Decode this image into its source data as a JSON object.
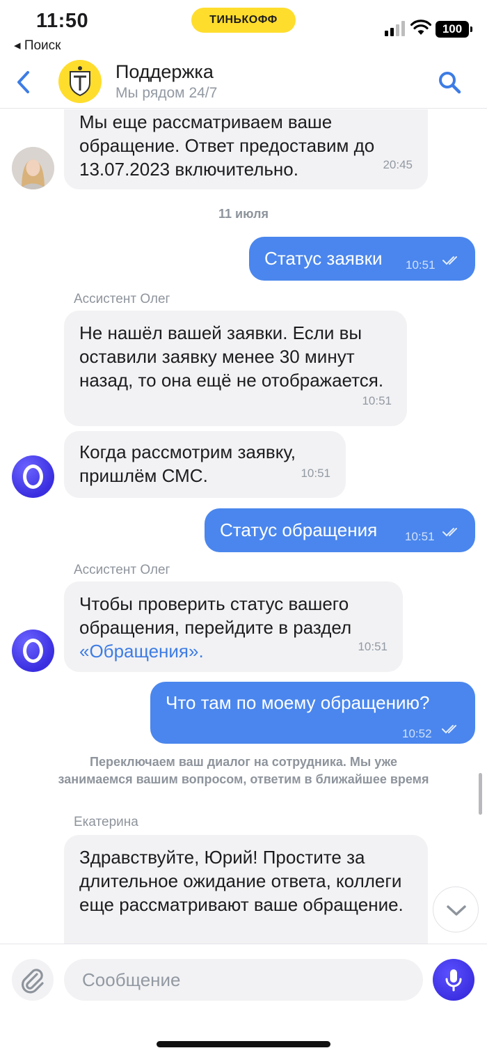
{
  "status_bar": {
    "time": "11:50",
    "brand": "ТИНЬКОФФ",
    "back_label": "◂ Поиск",
    "battery": "100"
  },
  "header": {
    "title": "Поддержка",
    "subtitle": "Мы рядом 24/7"
  },
  "messages": [
    {
      "direction": "incoming",
      "text": "Мы еще рассматриваем ваше обращение. Ответ предоставим до 13.07.2023 включительно.",
      "time": "20:45"
    },
    {
      "type": "date",
      "text": "11 июля"
    },
    {
      "direction": "outgoing",
      "text": "Статус заявки",
      "time": "10:51",
      "read": true
    },
    {
      "sender": "Ассистент Олег"
    },
    {
      "direction": "incoming",
      "text": "Не нашёл вашей заявки. Если вы оставили заявку менее 30 минут назад, то она ещё не отображается.",
      "time": "10:51"
    },
    {
      "direction": "incoming",
      "text": "Когда рассмотрим заявку, пришлём СМС.",
      "time": "10:51"
    },
    {
      "direction": "outgoing",
      "text": "Статус обращения",
      "time": "10:51",
      "read": true
    },
    {
      "sender": "Ассистент Олег"
    },
    {
      "direction": "incoming",
      "text": "Чтобы проверить статус вашего обращения, перейдите в раздел",
      "link": "«Обращения».",
      "time": "10:51"
    },
    {
      "direction": "outgoing",
      "text": "Что там по моему обращению?",
      "time": "10:52",
      "read": true
    },
    {
      "type": "system",
      "text": "Переключаем ваш диалог на сотрудника. Мы уже занимаемся вашим вопросом, ответим в ближайшее время"
    },
    {
      "sender": "Екатерина"
    },
    {
      "direction": "incoming",
      "text": "Здравствуйте, Юрий! Простите за длительное ожидание ответа, коллеги еще рассматривают ваше обращение."
    }
  ],
  "composer": {
    "placeholder": "Сообщение"
  },
  "colors": {
    "accent": "#4a86ed",
    "brand_yellow": "#ffdd2d",
    "incoming_bubble": "#f2f2f4",
    "bot_avatar": "#3a2ee0"
  },
  "icons": [
    "back-chevron-icon",
    "search-icon",
    "paperclip-icon",
    "microphone-icon",
    "chevron-down-icon",
    "double-check-icon",
    "wifi-icon",
    "signal-icon"
  ]
}
